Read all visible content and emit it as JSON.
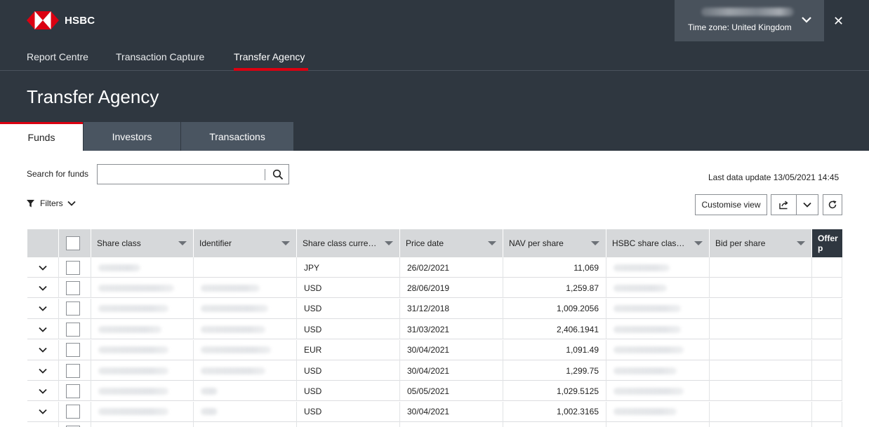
{
  "brand": {
    "name": "HSBC",
    "logo_color": "#db0011"
  },
  "user": {
    "timezone": "Time zone: United Kingdom"
  },
  "nav": {
    "items": [
      {
        "label": "Report Centre"
      },
      {
        "label": "Transaction Capture"
      },
      {
        "label": "Transfer Agency",
        "active": true
      }
    ]
  },
  "page": {
    "title": "Transfer Agency"
  },
  "tabs": [
    {
      "label": "Funds",
      "active": true
    },
    {
      "label": "Investors"
    },
    {
      "label": "Transactions"
    }
  ],
  "search": {
    "label": "Search for funds",
    "value": "",
    "placeholder": ""
  },
  "last_update": "Last data update 13/05/2021 14:45",
  "filters": {
    "label": "Filters"
  },
  "toolbar": {
    "customise_label": "Customise view"
  },
  "table": {
    "columns": [
      "Share class",
      "Identifier",
      "Share class curre…",
      "Price date",
      "NAV per share",
      "HSBC share clas…",
      "Bid per share",
      "Offer p"
    ],
    "rows": [
      {
        "currency": "JPY",
        "price_date": "26/02/2021",
        "nav": "11,069"
      },
      {
        "currency": "USD",
        "price_date": "28/06/2019",
        "nav": "1,259.87"
      },
      {
        "currency": "USD",
        "price_date": "31/12/2018",
        "nav": "1,009.2056"
      },
      {
        "currency": "USD",
        "price_date": "31/03/2021",
        "nav": "2,406.1941"
      },
      {
        "currency": "EUR",
        "price_date": "30/04/2021",
        "nav": "1,091.49"
      },
      {
        "currency": "USD",
        "price_date": "30/04/2021",
        "nav": "1,299.75"
      },
      {
        "currency": "USD",
        "price_date": "05/05/2021",
        "nav": "1,029.5125"
      },
      {
        "currency": "USD",
        "price_date": "30/04/2021",
        "nav": "1,002.3165"
      },
      {
        "currency": "",
        "price_date": "",
        "nav": ""
      }
    ]
  },
  "icons": {
    "logo": "hsbc-hexagon-logo",
    "user_menu": "chevron-down-icon",
    "close": "close-icon",
    "search": "search-icon",
    "filter": "filter-icon",
    "export": "export-icon",
    "refresh": "refresh-icon",
    "row_expand": "chevron-down-icon"
  }
}
